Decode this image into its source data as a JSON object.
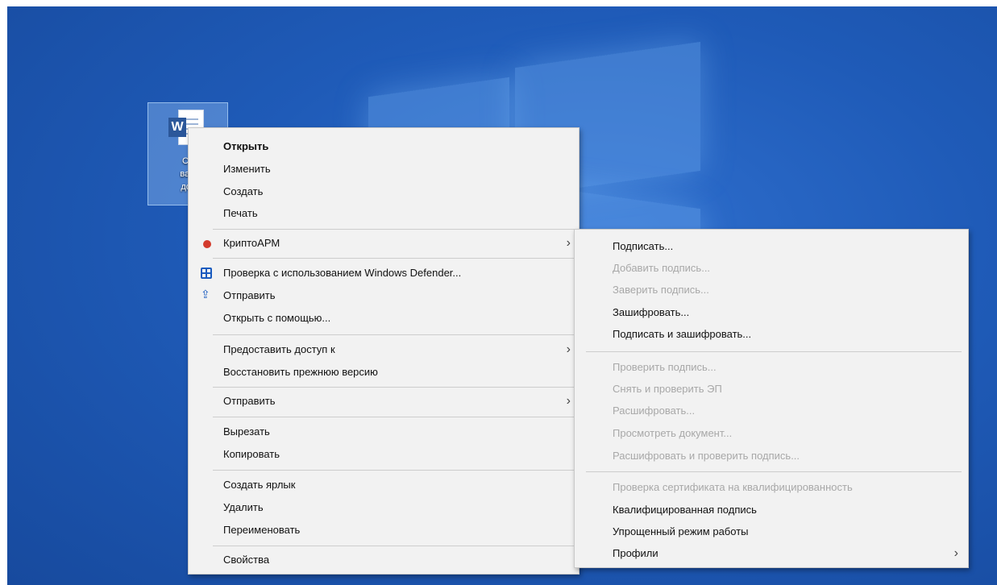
{
  "desktop": {
    "file_label_lines": [
      "Се",
      "важ",
      "док"
    ],
    "file_icon_letter": "W"
  },
  "main_menu": [
    {
      "label": "Открыть",
      "bold": true
    },
    {
      "label": "Изменить"
    },
    {
      "label": "Создать"
    },
    {
      "label": "Печать"
    },
    {
      "label": "КриптоАРМ",
      "icon": "cryptoarm-icon",
      "submenu": true
    },
    {
      "label": "Проверка с использованием Windows Defender...",
      "icon": "defender-shield-icon"
    },
    {
      "label": "Отправить",
      "icon": "share-icon"
    },
    {
      "label": "Открыть с помощью..."
    },
    {
      "label": "Предоставить доступ к",
      "submenu": true
    },
    {
      "label": "Восстановить прежнюю версию"
    },
    {
      "label": "Отправить",
      "submenu": true
    },
    {
      "label": "Вырезать"
    },
    {
      "label": "Копировать"
    },
    {
      "label": "Создать ярлык"
    },
    {
      "label": "Удалить"
    },
    {
      "label": "Переименовать"
    },
    {
      "label": "Свойства"
    }
  ],
  "sub_menu": [
    {
      "label": "Подписать...",
      "enabled": true
    },
    {
      "label": "Добавить подпись...",
      "enabled": false
    },
    {
      "label": "Заверить подпись...",
      "enabled": false
    },
    {
      "label": "Зашифровать...",
      "enabled": true
    },
    {
      "label": "Подписать и зашифровать...",
      "enabled": true
    },
    {
      "label": "Проверить подпись...",
      "enabled": false
    },
    {
      "label": "Снять и проверить ЭП",
      "enabled": false
    },
    {
      "label": "Расшифровать...",
      "enabled": false
    },
    {
      "label": "Просмотреть документ...",
      "enabled": false
    },
    {
      "label": "Расшифровать и проверить подпись...",
      "enabled": false
    },
    {
      "label": "Проверка сертификата на квалифицированность",
      "enabled": false
    },
    {
      "label": "Квалифицированная подпись",
      "enabled": true
    },
    {
      "label": "Упрощенный режим работы",
      "enabled": true
    },
    {
      "label": "Профили",
      "enabled": true,
      "submenu": true
    }
  ],
  "submenu_arrow": "›"
}
